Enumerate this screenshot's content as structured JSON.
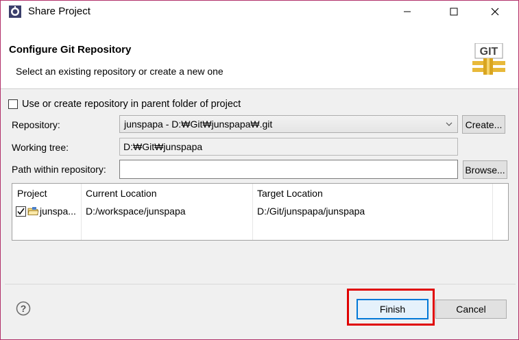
{
  "window": {
    "title": "Share Project",
    "controls": [
      "minimize",
      "maximize",
      "close"
    ]
  },
  "header": {
    "title": "Configure Git Repository",
    "description": "Select an existing repository or create a new one",
    "icon": "git-icon",
    "icon_text": "GIT"
  },
  "form": {
    "use_parent_label": "Use or create repository in parent folder of project",
    "use_parent_checked": false,
    "repository_label": "Repository:",
    "repository_value": "junspapa - D:₩Git₩junspapa₩.git",
    "create_button": "Create...",
    "working_tree_label": "Working tree:",
    "working_tree_value": "D:₩Git₩junspapa",
    "path_label": "Path within repository:",
    "path_value": "",
    "browse_button": "Browse..."
  },
  "table": {
    "columns": [
      "Project",
      "Current Location",
      "Target Location"
    ],
    "rows": [
      {
        "checked": true,
        "project": "junspa...",
        "current": "D:/workspace/junspapa",
        "target": "D:/Git/junspapa/junspapa"
      }
    ]
  },
  "footer": {
    "finish_button": "Finish",
    "cancel_button": "Cancel"
  },
  "colors": {
    "highlight": "#e00000",
    "default_button_border": "#0078d7",
    "window_border": "#b0306a"
  }
}
